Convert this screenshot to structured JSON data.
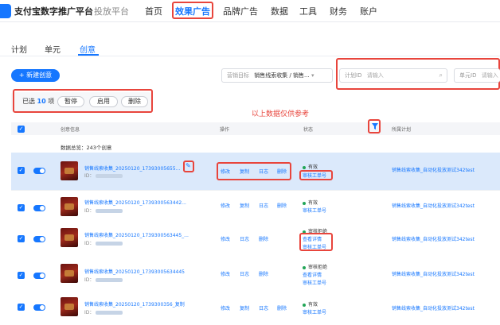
{
  "nav": {
    "brand": "支付宝数字推广平台",
    "brand_secondary": "投放平台",
    "items": [
      {
        "label": "首页"
      },
      {
        "label": "效果广告"
      },
      {
        "label": "品牌广告"
      },
      {
        "label": "数据"
      },
      {
        "label": "工具"
      },
      {
        "label": "财务"
      },
      {
        "label": "账户"
      }
    ],
    "active": "效果广告"
  },
  "tabs": [
    {
      "label": "计划"
    },
    {
      "label": "单元"
    },
    {
      "label": "创意"
    }
  ],
  "toolbar": {
    "new_label": "+ 新建创意",
    "goal_label": "营销目标",
    "goal_value": "销售线索收集 / 销售...",
    "plan_id_label": "计划ID",
    "plan_id_placeholder": "请输入",
    "unit_id_label": "单元ID",
    "unit_id_placeholder": "请输入"
  },
  "selection": {
    "prefix": "已选",
    "count": "10",
    "suffix": "项",
    "pause": "暂停",
    "enable": "启用",
    "delete": "删除"
  },
  "annotation": "以上数据仅供参考",
  "table": {
    "headers": {
      "info": "创意信息",
      "ops": "操作",
      "status": "状态",
      "plan": "所属计划"
    },
    "summary": "数据总览：243个创意",
    "rows": [
      {
        "name": "销售线索收集_20250120_17393005655...",
        "id": "ID：",
        "actions": [
          "修改",
          "复制",
          "日志",
          "删除"
        ],
        "status": "有效",
        "status_link": "审核工单号",
        "plan": "销售线索收集_自动化投放测试342test"
      },
      {
        "name": "销售线索收集_20250120_1739300563442...",
        "id": "ID：",
        "actions": [
          "修改",
          "复制",
          "日志",
          "删除"
        ],
        "status": "有效",
        "status_link": "审核工单号",
        "plan": "销售线索收集_自动化投放测试342test"
      },
      {
        "name": "销售线索收集_20250120_1739300563445_...",
        "id": "ID：",
        "actions": [
          "修改",
          "日志",
          "删除"
        ],
        "status": "审核拒绝",
        "status_link": "查看详情",
        "status_link2": "审核工单号",
        "plan": "销售线索收集_自动化投放测试342test"
      },
      {
        "name": "销售线索收集_20250120_17393005634445",
        "id": "ID：",
        "actions": [
          "修改",
          "日志",
          "删除"
        ],
        "status": "审核拒绝",
        "status_link": "查看详情",
        "status_link2": "审核工单号",
        "plan": "销售线索收集_自动化投放测试342test"
      },
      {
        "name": "销售线索收集_20250120_1739300356_复制",
        "id": "ID：",
        "actions": [
          "修改",
          "复制",
          "日志",
          "删除"
        ],
        "status": "有效",
        "status_link": "审核工单号",
        "plan": "销售线索收集_自动化投放测试342test"
      }
    ]
  },
  "colors": {
    "accent": "#1677ff",
    "highlight_box": "#e8453c",
    "selected_row": "#dbe9fb"
  }
}
